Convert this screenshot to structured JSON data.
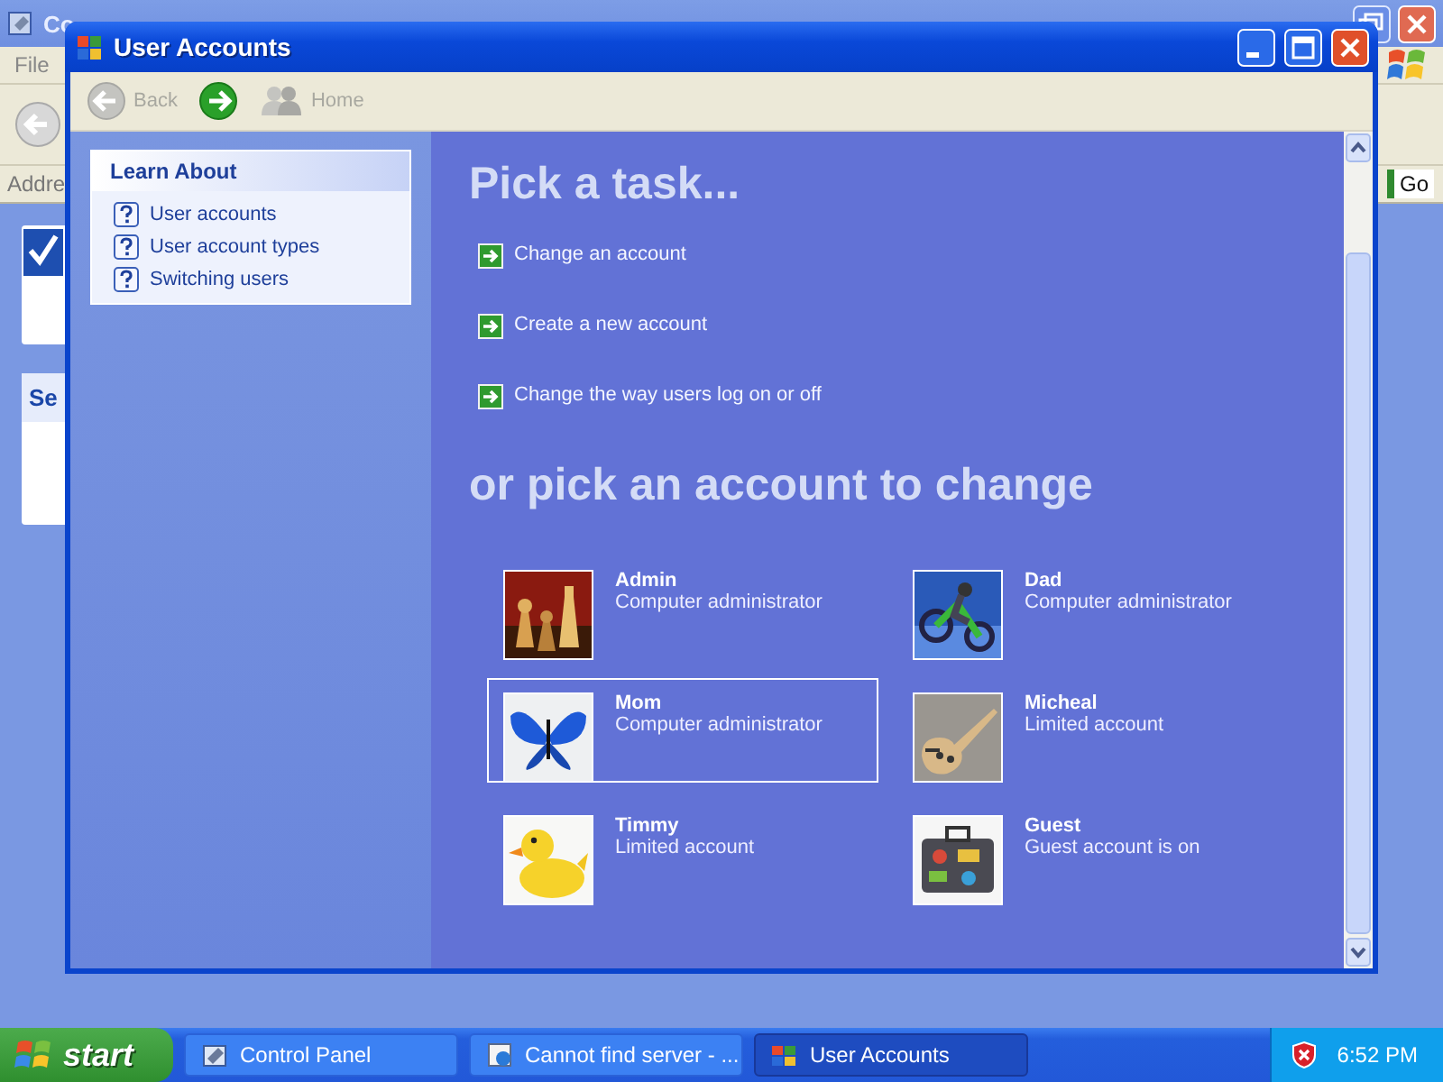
{
  "background_window": {
    "title": "Co",
    "menu": [
      "File"
    ],
    "address_label": "Addre",
    "go_button": "Go",
    "panel_heading": "Se"
  },
  "window": {
    "title": "User Accounts"
  },
  "toolbar": [
    {
      "kind": "back",
      "label": "Back",
      "disabled": true
    },
    {
      "kind": "forward",
      "disabled": false
    },
    {
      "kind": "home",
      "label": "Home",
      "disabled": true
    }
  ],
  "learn_about": {
    "heading": "Learn About",
    "items": [
      "User accounts",
      "User account types",
      "Switching users"
    ]
  },
  "task_heading": "Pick a task...",
  "tasks": [
    "Change an account",
    "Create a new account",
    "Change the way users log on or off"
  ],
  "account_heading": "or pick an account to change",
  "accounts": [
    {
      "name": "Admin",
      "type": "Computer administrator",
      "selected": false
    },
    {
      "name": "Dad",
      "type": "Computer administrator",
      "selected": false
    },
    {
      "name": "Mom",
      "type": "Computer administrator",
      "selected": true
    },
    {
      "name": "Micheal",
      "type": "Limited account",
      "selected": false
    },
    {
      "name": "Timmy",
      "type": "Limited account",
      "selected": false
    },
    {
      "name": "Guest",
      "type": "Guest account is on",
      "selected": false
    }
  ],
  "taskbar": {
    "start": "start",
    "buttons": [
      {
        "label": "Control Panel",
        "selected": false
      },
      {
        "label": "Cannot find server - ...",
        "selected": false
      },
      {
        "label": "User Accounts",
        "selected": true
      }
    ],
    "clock": "6:52 PM"
  }
}
